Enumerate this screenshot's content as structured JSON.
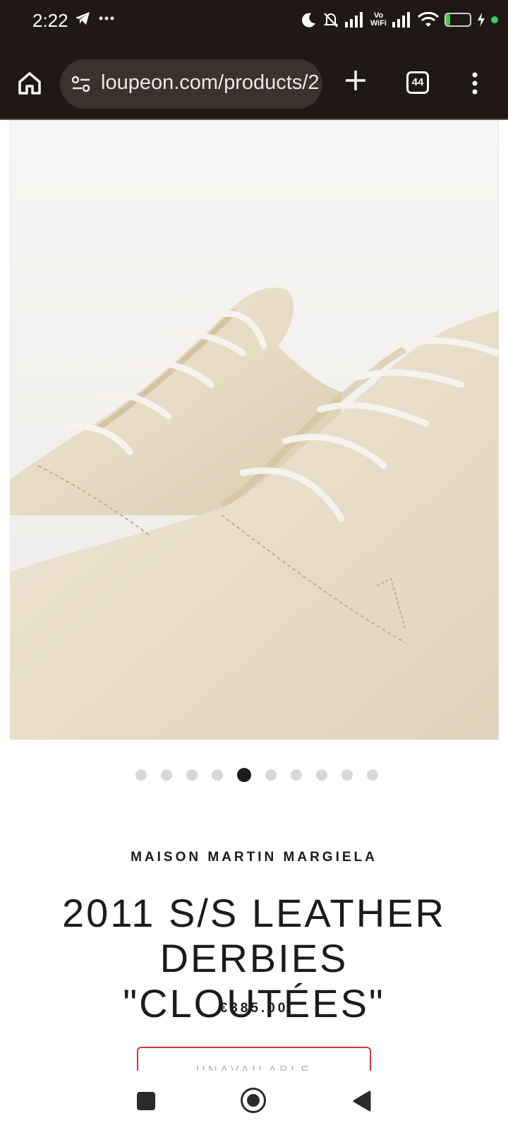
{
  "status_bar": {
    "time": "2:22",
    "vowifi_line1": "Vo",
    "vowifi_line2": "WiFi",
    "battery_level": "19",
    "icons": [
      "telegram-icon",
      "more-dots-icon",
      "moon-icon",
      "bell-off-icon",
      "signal-icon",
      "vowifi-icon",
      "signal-icon",
      "wifi-icon",
      "battery-icon",
      "charging-icon"
    ]
  },
  "browser": {
    "url": "loupeon.com/products/2",
    "tab_count": "44",
    "icons": [
      "home-icon",
      "site-settings-icon",
      "new-tab-plus-icon",
      "tabs-icon",
      "overflow-menu-icon"
    ]
  },
  "carousel": {
    "total": 10,
    "active_index": 4
  },
  "product": {
    "vendor": "MAISON MARTIN MARGIELA",
    "title_line1": "2011 S/S LEATHER",
    "title_line2": "DERBIES \"CLOUTÉES\"",
    "price": "€385.00",
    "button_label": "UNAVAILABLE"
  },
  "colors": {
    "browser_chrome": "#201815",
    "url_pill": "#3b322e",
    "button_border": "#c93b33",
    "text": "#1b1b1b"
  }
}
